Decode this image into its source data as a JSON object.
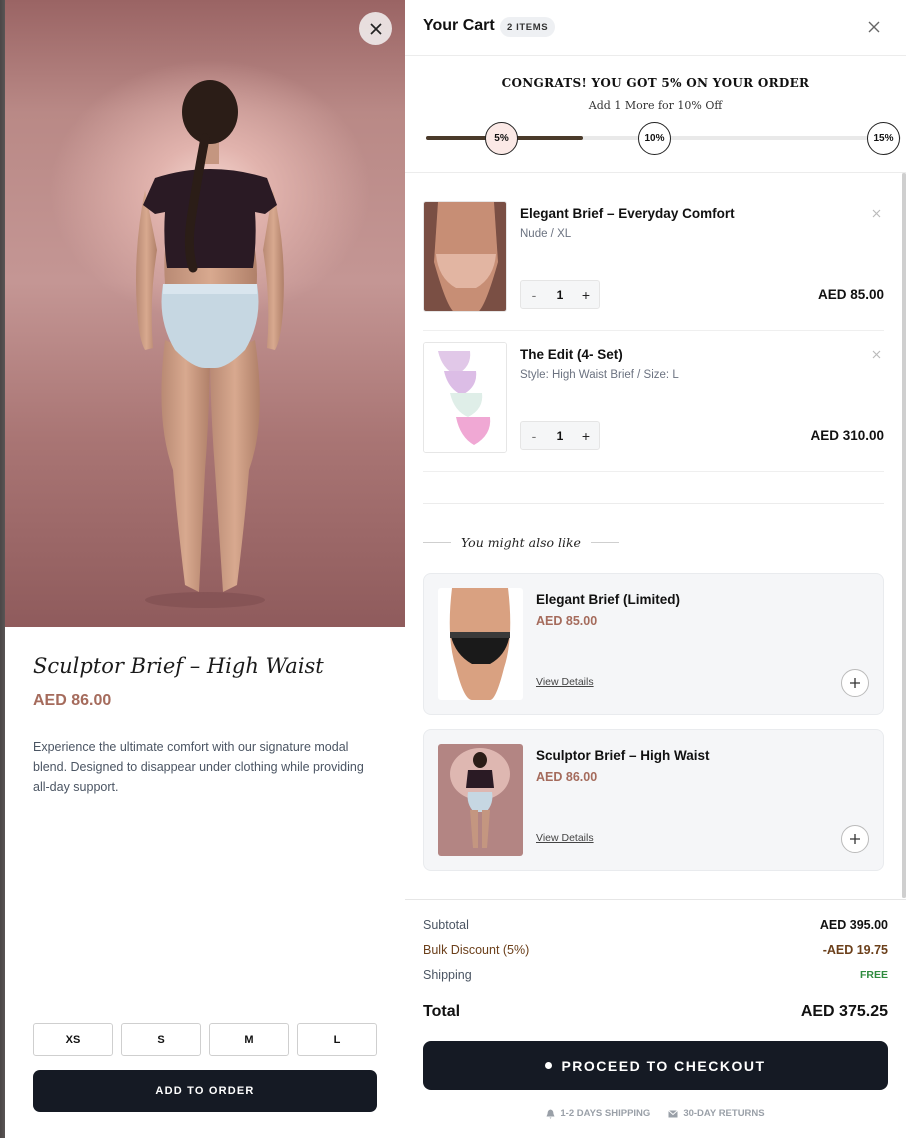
{
  "quickview": {
    "title": "Sculptor Brief – High Waist",
    "price": "AED 86.00",
    "description": "Experience the ultimate comfort with our signature modal blend. Designed to disappear under clothing while providing all-day support.",
    "sizes": [
      "XS",
      "S",
      "M",
      "L"
    ],
    "add_label": "ADD TO ORDER"
  },
  "cart": {
    "title": "Your Cart",
    "count_badge": "2 ITEMS",
    "promo": {
      "headline": "CONGRATS! YOU GOT 5% ON YOUR ORDER",
      "subline": "Add 1 More for 10% Off",
      "progress_fraction": 0.33,
      "milestones": [
        "5%",
        "10%",
        "15%"
      ]
    },
    "items": [
      {
        "name": "Elegant Brief – Everyday Comfort",
        "variant": "Nude / XL",
        "quantity": "1",
        "price": "AED 85.00",
        "minus": "-",
        "plus": "+"
      },
      {
        "name": "The Edit (4- Set)",
        "variant": "Style: High Waist Brief / Size: L",
        "quantity": "1",
        "price": "AED 310.00",
        "minus": "-",
        "plus": "+"
      }
    ],
    "recommendations_heading": "You might also like",
    "recommendations": [
      {
        "name": "Elegant Brief (Limited)",
        "price": "AED 85.00",
        "link": "View Details"
      },
      {
        "name": "Sculptor Brief – High Waist",
        "price": "AED 86.00",
        "link": "View Details"
      }
    ],
    "summary": {
      "subtotal_label": "Subtotal",
      "subtotal": "AED 395.00",
      "discount_label": "Bulk Discount (5%)",
      "discount": "-AED 19.75",
      "shipping_label": "Shipping",
      "shipping": "FREE",
      "total_label": "Total",
      "total": "AED 375.25"
    },
    "checkout_label": "PROCEED TO CHECKOUT",
    "badges": [
      "1-2 DAYS SHIPPING",
      "30-DAY RETURNS"
    ]
  },
  "colors": {
    "dark_button": "#151a24",
    "accent_price": "#a56b5c",
    "discount": "#6b3f1a",
    "free_shipping": "#2e8b3e",
    "progress_fill": "#4a3a2a"
  }
}
